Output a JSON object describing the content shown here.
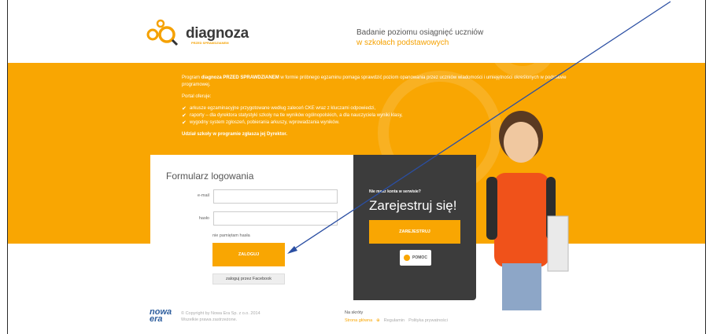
{
  "header": {
    "logo_text": "diagnoza",
    "logo_sub": "PRZED SPRAWDZIANEM",
    "tagline_line1": "Badanie poziomu osiągnięć uczniów",
    "tagline_line2": "w szkołach podstawowych"
  },
  "intro": {
    "p1_prefix": "Program ",
    "p1_bold": "diagnoza PRZED SPRAWDZIANEM",
    "p1_rest": " w formie próbnego egzaminu pomaga sprawdzić poziom opanowania przez uczniów wiadomości i umiejętności określonych w podstawie programowej.",
    "portal_offers": "Portal oferuje:",
    "items": [
      "arkusze egzaminacyjne przygotowane według zaleceń CKE wraz z kluczami odpowiedzi,",
      "raporty – dla dyrektora statystyki szkoły na tle wyników ogólnopolskich, a dla nauczyciela wyniki klasy,",
      "wygodny system zgłoszeń, pobierania arkuszy, wprowadzania wyników."
    ],
    "footer_bold": "Udział szkoły w programie zgłasza jej Dyrektor."
  },
  "login": {
    "title": "Formularz logowania",
    "email_label": "e-mail",
    "email_value": "",
    "password_label": "hasło",
    "password_value": "",
    "forgot": "nie pamiętam hasła",
    "login_button": "ZALOGUJ",
    "facebook_button": "zaloguj przez Facebook"
  },
  "register": {
    "question": "Nie masz konta w serwisie?",
    "title": "Zarejestruj się!",
    "button": "ZAREJESTRUJ",
    "help": "POMOC"
  },
  "footer": {
    "brand_line1": "nowa",
    "brand_line2": "era",
    "copyright_line1": "© Copyright by Nowa Era Sp. z o.o. 2014",
    "copyright_line2": "Wszelkie prawa zastrzeżone.",
    "shortcuts_title": "Na skróty",
    "links": [
      "Strona główna",
      "Regulamin",
      "Polityka prywatności"
    ]
  },
  "colors": {
    "accent": "#f9a602",
    "dark_panel": "#3c3c3c",
    "annotation_arrow": "#2b4fa3"
  }
}
